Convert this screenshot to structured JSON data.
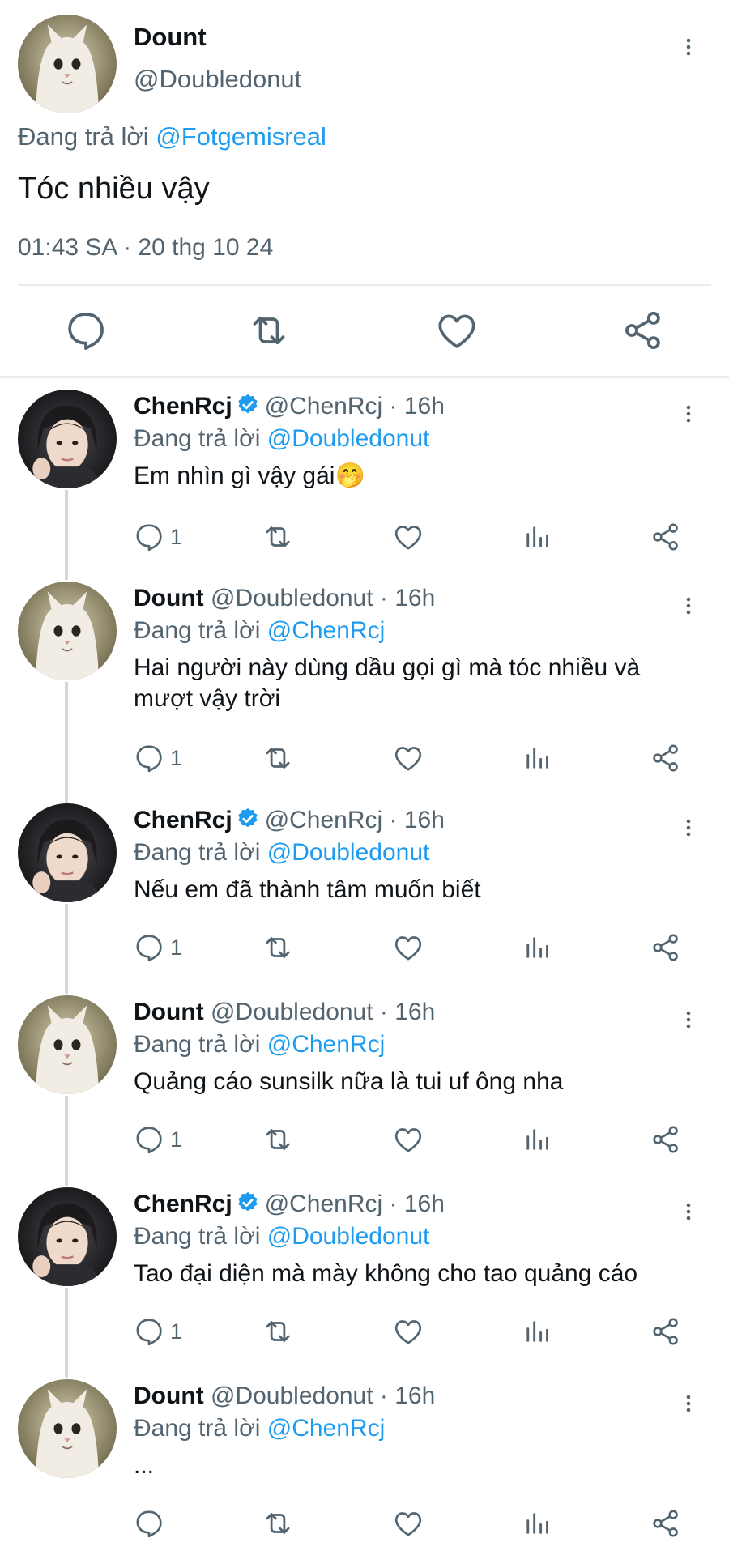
{
  "main_tweet": {
    "name": "Dount",
    "handle": "@Doubledonut",
    "replying_prefix": "Đang trả lời",
    "replying_to": "@Fotgemisreal",
    "text": "Tóc nhiều vậy",
    "timestamp": "01:43 SA · 20 thg 10 24"
  },
  "icons": {
    "reply": "reply-bubble-icon",
    "retweet": "retweet-icon",
    "like": "heart-icon",
    "share": "share-icon",
    "views": "views-bar-chart-icon",
    "more": "more-vertical-icon",
    "verified": "verified-badge-icon"
  },
  "colors": {
    "accent": "#1d9bf0",
    "muted_text": "#536471",
    "divider": "#e6ecf0"
  },
  "replies": [
    {
      "name": "ChenRcj",
      "verified": true,
      "handle_time": "@ChenRcj · 16h",
      "replying_prefix": "Đang trả lời",
      "replying_to": "@Doubledonut",
      "text": "Em nhìn gì vậy gái🤭",
      "reply_count": "1"
    },
    {
      "name": "Dount",
      "verified": false,
      "handle_time": "@Doubledonut · 16h",
      "replying_prefix": "Đang trả lời",
      "replying_to": "@ChenRcj",
      "text": "Hai người này dùng dầu gọi gì mà tóc nhiều và mượt vậy trời",
      "reply_count": "1"
    },
    {
      "name": "ChenRcj",
      "verified": true,
      "handle_time": "@ChenRcj · 16h",
      "replying_prefix": "Đang trả lời",
      "replying_to": "@Doubledonut",
      "text": "Nếu em đã thành tâm muốn biết",
      "reply_count": "1"
    },
    {
      "name": "Dount",
      "verified": false,
      "handle_time": "@Doubledonut · 16h",
      "replying_prefix": "Đang trả lời",
      "replying_to": "@ChenRcj",
      "text": "Quảng cáo sunsilk nữa là tui uf ông nha",
      "reply_count": "1"
    },
    {
      "name": "ChenRcj",
      "verified": true,
      "handle_time": "@ChenRcj · 16h",
      "replying_prefix": "Đang trả lời",
      "replying_to": "@Doubledonut",
      "text": "Tao đại diện mà mày không cho tao quảng cáo",
      "reply_count": "1"
    },
    {
      "name": "Dount",
      "verified": false,
      "handle_time": "@Doubledonut · 16h",
      "replying_prefix": "Đang trả lời",
      "replying_to": "@ChenRcj",
      "text": "...",
      "reply_count": ""
    }
  ]
}
